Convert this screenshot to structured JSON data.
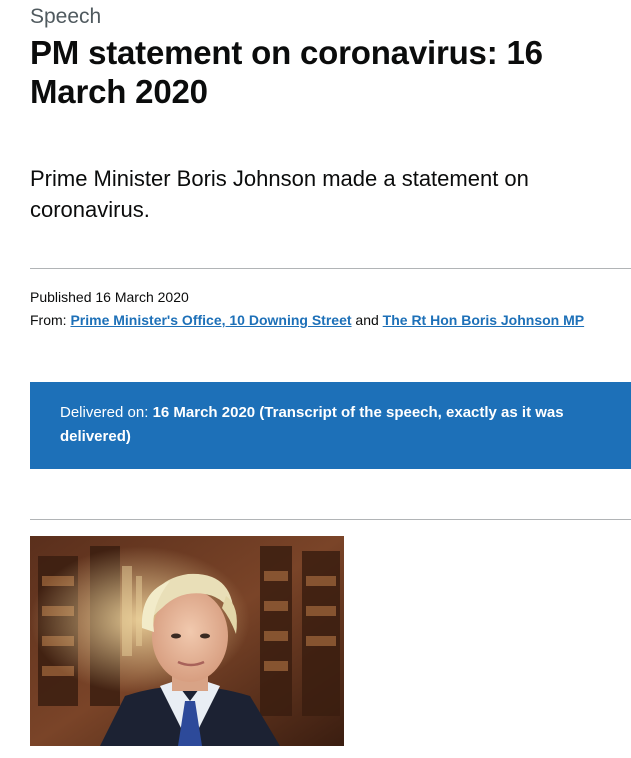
{
  "document_type": "Speech",
  "title": "PM statement on coronavirus: 16 March 2020",
  "summary": "Prime Minister Boris Johnson made a statement on coronavirus.",
  "metadata": {
    "published_label": "Published",
    "published_date": "16 March 2020",
    "from_label": "From:",
    "organisations": [
      "Prime Minister's Office, 10 Downing Street",
      "The Rt Hon Boris Johnson MP"
    ],
    "and_text": "and"
  },
  "delivered": {
    "label": "Delivered on:",
    "value": "16 March 2020 (Transcript of the speech, exactly as it was delivered)"
  },
  "colors": {
    "link": "#1d70b8",
    "banner": "#1d70b8",
    "text": "#0b0c0c",
    "secondary_text": "#505a5f",
    "rule": "#b1b4b6"
  }
}
